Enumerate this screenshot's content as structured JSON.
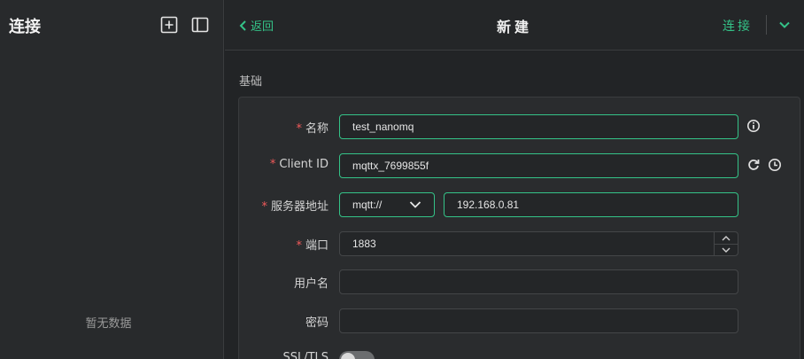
{
  "sidebar": {
    "title": "连接",
    "empty_text": "暂无数据",
    "icons": [
      "add-connection-icon",
      "toggle-panel-icon"
    ]
  },
  "header": {
    "back_label": "返回",
    "title": "新建",
    "connect_label": "连接"
  },
  "section": {
    "basic_label": "基础"
  },
  "form": {
    "name": {
      "label": "名称",
      "value": "test_nanomq"
    },
    "client_id": {
      "label": "Client ID",
      "value": "mqttx_7699855f"
    },
    "host": {
      "label": "服务器地址",
      "protocol": "mqtt://",
      "value": "192.168.0.81"
    },
    "port": {
      "label": "端口",
      "value": "1883"
    },
    "username": {
      "label": "用户名",
      "value": ""
    },
    "password": {
      "label": "密码",
      "value": ""
    },
    "ssl": {
      "label": "SSL/TLS",
      "enabled": false
    }
  },
  "colors": {
    "accent": "#34c388",
    "required": "#f25a5a"
  }
}
